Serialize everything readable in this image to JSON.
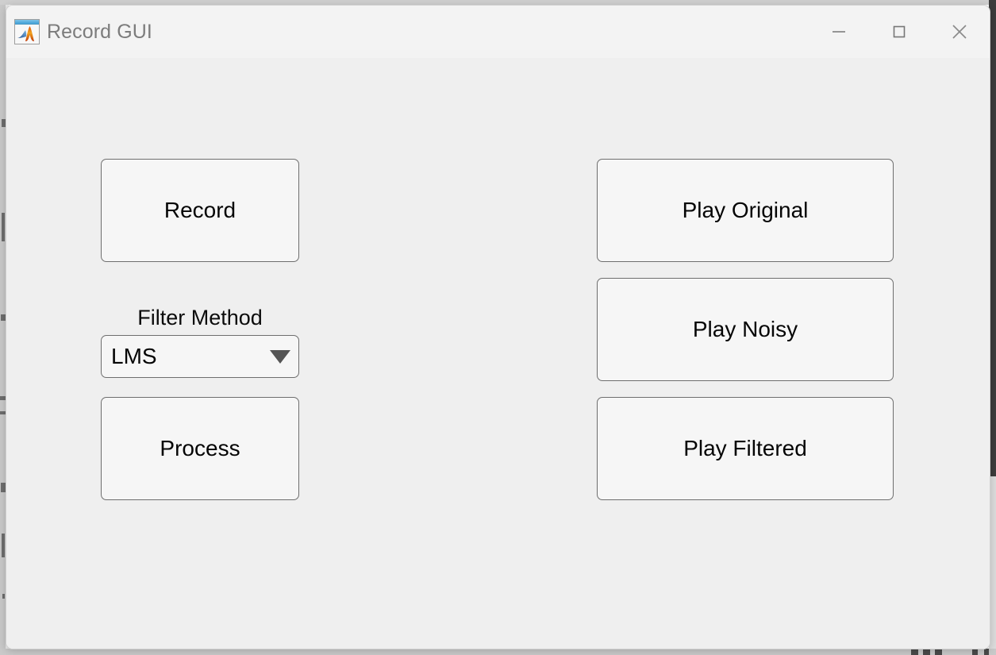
{
  "window": {
    "title": "Record GUI",
    "icon": "matlab-membrane-icon",
    "controls": {
      "minimize": "minimize-icon",
      "maximize": "maximize-icon",
      "close": "close-icon"
    },
    "colors": {
      "titlebar_bg": "#f3f3f3",
      "client_bg": "#efefef",
      "button_bg": "#f6f6f6",
      "button_border": "#6e6e6e",
      "title_text": "#7c7c7c",
      "body_text": "#050505",
      "dropdown_arrow": "#555555"
    }
  },
  "main": {
    "left_column": {
      "record_button": "Record",
      "filter_label": "Filter Method",
      "filter_dropdown": {
        "selected": "LMS",
        "arrow_icon": "chevron-down-icon"
      },
      "process_button": "Process"
    },
    "right_column": {
      "play_original_button": "Play Original",
      "play_noisy_button": "Play Noisy",
      "play_filtered_button": "Play Filtered"
    }
  }
}
